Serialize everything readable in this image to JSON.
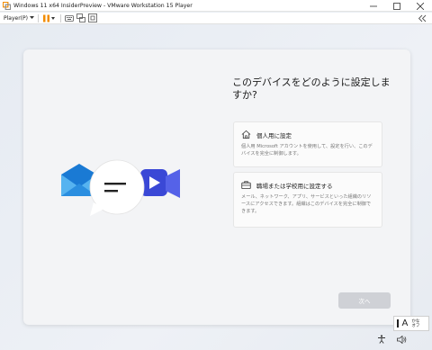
{
  "window": {
    "title": "Windows 11 x64 InsiderPreview - VMware Workstation 15 Player"
  },
  "toolbar": {
    "player_menu": "Player(P)"
  },
  "oobe": {
    "heading": "このデバイスをどのように設定しますか?",
    "options": [
      {
        "title": "個人用に設定",
        "description": "個人用 Microsoft アカウントを使用して、設定を行い、このデバイスを完全に制御します。",
        "icon": "home-icon"
      },
      {
        "title": "職場または学校用に設定する",
        "description": "メール、ネットワーク、アプリ、サービスといった組織のリソースにアクセスできます。組織はこのデバイスを完全に制御できます。",
        "icon": "briefcase-icon"
      }
    ],
    "next_label": "次へ"
  },
  "ime": {
    "mode": "A",
    "kana_line1": "かな",
    "kana_line2": "オフ"
  },
  "colors": {
    "vmware_orange": "#f28c00",
    "mail_blue": "#1a7ad4",
    "video_blue": "#3a48d6",
    "button_disabled": "#cfd1d6"
  }
}
